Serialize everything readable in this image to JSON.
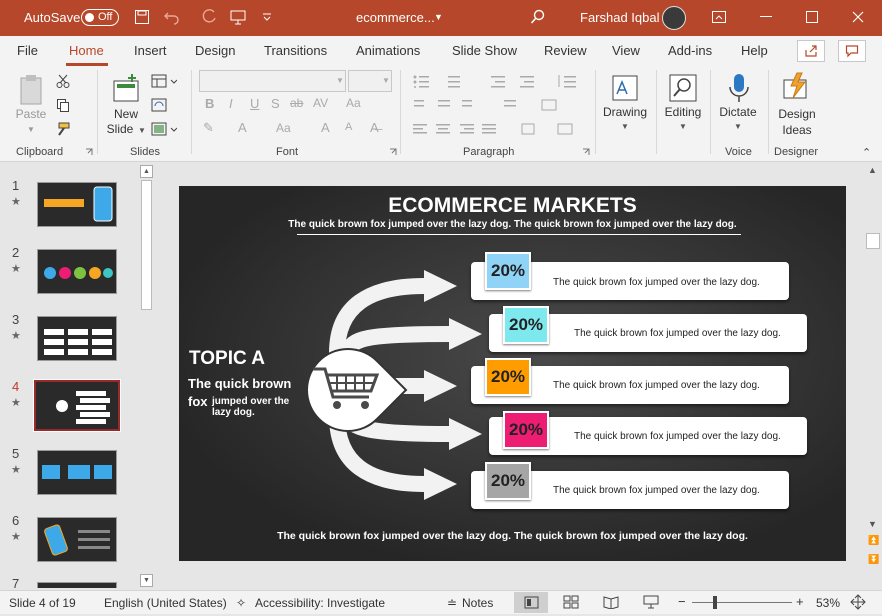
{
  "titlebar": {
    "autosave": "AutoSave",
    "toggle": "Off",
    "doc": "ecommerce...",
    "user": "Farshad Iqbal"
  },
  "tabs": [
    "File",
    "Home",
    "Insert",
    "Design",
    "Transitions",
    "Animations",
    "Slide Show",
    "Review",
    "View",
    "Add-ins",
    "Help"
  ],
  "ribbon": {
    "paste": "Paste",
    "new_slide_1": "New",
    "new_slide_2": "Slide",
    "drawing": "Drawing",
    "editing": "Editing",
    "dictate": "Dictate",
    "design_ideas_1": "Design",
    "design_ideas_2": "Ideas",
    "groups": {
      "clipboard": "Clipboard",
      "slides": "Slides",
      "font": "Font",
      "paragraph": "Paragraph",
      "voice": "Voice",
      "designer": "Designer"
    }
  },
  "thumbnails": {
    "numbers": [
      "1",
      "2",
      "3",
      "4",
      "5",
      "6",
      "7"
    ],
    "star": "★"
  },
  "slide": {
    "title": "ECOMMERCE MARKETS",
    "subtitle": "The quick brown fox jumped over the lazy dog. The quick brown fox jumped over the lazy dog.",
    "topic": "TOPIC A",
    "topic_text_bold1": "The quick brown",
    "topic_text_bold2": "fox",
    "topic_text_rest": "jumped over the lazy dog.",
    "footer": "The quick brown fox jumped over the lazy dog. The quick brown fox jumped over the lazy dog.",
    "rows": [
      {
        "pct": "20%",
        "text": "The quick brown fox jumped over the lazy dog.",
        "color": "#8fd3f6"
      },
      {
        "pct": "20%",
        "text": "The quick brown fox jumped over the lazy dog.",
        "color": "#7ee8ef"
      },
      {
        "pct": "20%",
        "text": "The quick brown fox jumped over the lazy dog.",
        "color": "#ff9c00"
      },
      {
        "pct": "20%",
        "text": "The quick brown fox jumped over the lazy dog.",
        "color": "#ec1d73"
      },
      {
        "pct": "20%",
        "text": "The quick brown fox jumped over the lazy dog.",
        "color": "#a5a5a5"
      }
    ]
  },
  "status": {
    "slide": "Slide 4 of 19",
    "lang": "English (United States)",
    "access": "Accessibility: Investigate",
    "notes": "Notes",
    "zoom": "53%"
  }
}
